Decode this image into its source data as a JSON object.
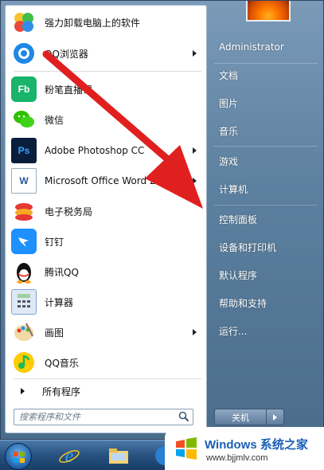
{
  "programs": [
    {
      "label": "强力卸载电脑上的软件",
      "icon": "pinwheel-icon",
      "color": "#f0f0f0",
      "arrow": false
    },
    {
      "label": "QQ浏览器",
      "icon": "qq-browser-icon",
      "color": "#1e88e5",
      "arrow": true
    },
    {
      "label": "粉笔直播课",
      "icon": "fenbi-icon",
      "color": "#19b36b",
      "arrow": false
    },
    {
      "label": "微信",
      "icon": "wechat-icon",
      "color": "#2dc100",
      "arrow": false
    },
    {
      "label": "Adobe Photoshop CC",
      "icon": "photoshop-icon",
      "color": "#0a1e3c",
      "arrow": true
    },
    {
      "label": "Microsoft Office Word 2007",
      "icon": "word-icon",
      "color": "#2b5797",
      "arrow": true
    },
    {
      "label": "电子税务局",
      "icon": "tax-bureau-icon",
      "color": "#e53935",
      "arrow": false
    },
    {
      "label": "钉钉",
      "icon": "dingtalk-icon",
      "color": "#1e90ff",
      "arrow": false
    },
    {
      "label": "腾讯QQ",
      "icon": "qq-penguin-icon",
      "color": "#111111",
      "arrow": false
    },
    {
      "label": "计算器",
      "icon": "calculator-icon",
      "color": "#7ea6d6",
      "arrow": false
    },
    {
      "label": "画图",
      "icon": "paint-palette-icon",
      "color": "#e0a030",
      "arrow": true
    },
    {
      "label": "QQ音乐",
      "icon": "qq-music-icon",
      "color": "#ffcc00",
      "arrow": false
    }
  ],
  "all_programs": "所有程序",
  "search": {
    "placeholder": "搜索程序和文件"
  },
  "user": {
    "name": "Administrator"
  },
  "right_items": [
    "文档",
    "图片",
    "音乐",
    "游戏",
    "计算机",
    "控制面板",
    "设备和打印机",
    "默认程序",
    "帮助和支持",
    "运行..."
  ],
  "shutdown_label": "关机",
  "watermark": {
    "title_en": "Windows",
    "title_cn": "系统之家",
    "url": "www.bjjmlv.com"
  },
  "colors": {
    "accent": "#1a5fb4",
    "arrow": "#e01f1f"
  }
}
